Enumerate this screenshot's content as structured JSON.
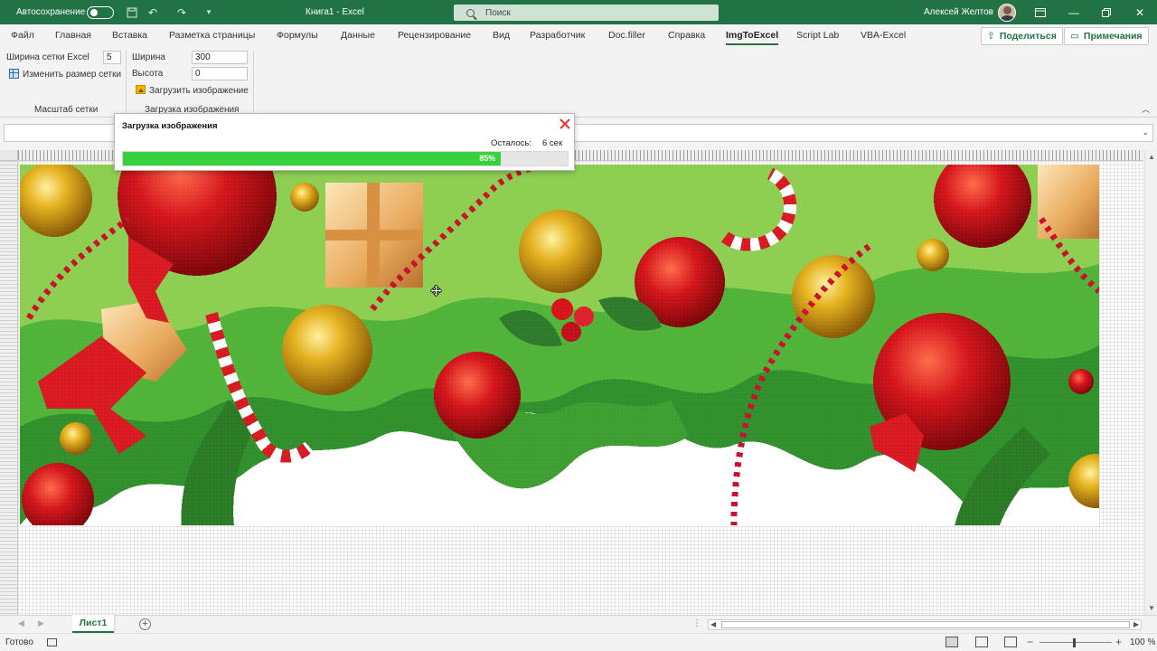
{
  "titlebar": {
    "autosave_label": "Автосохранение",
    "app_title": "Книга1  -  Excel",
    "search_placeholder": "Поиск",
    "user_name": "Алексей Желтов",
    "bg_color": "#217346"
  },
  "menu": {
    "tabs": [
      {
        "label": "Файл"
      },
      {
        "label": "Главная"
      },
      {
        "label": "Вставка"
      },
      {
        "label": "Разметка страницы"
      },
      {
        "label": "Формулы"
      },
      {
        "label": "Данные"
      },
      {
        "label": "Рецензирование"
      },
      {
        "label": "Вид"
      },
      {
        "label": "Разработчик"
      },
      {
        "label": "Doc.filler"
      },
      {
        "label": "Справка"
      },
      {
        "label": "ImgToExcel"
      },
      {
        "label": "Script Lab"
      },
      {
        "label": "VBA-Excel"
      }
    ],
    "active_tab": "ImgToExcel",
    "share_label": "Поделиться",
    "comments_label": "Примечания"
  },
  "ribbon": {
    "grid_size_label": "Ширина сетки Excel",
    "grid_size_value": "5",
    "resize_grid_label": "Изменить размер сетки",
    "group_scale_label": "Масштаб сетки",
    "width_label": "Ширина",
    "width_value": "300",
    "height_label": "Высота",
    "height_value": "0",
    "load_image_label": "Загрузить изображение",
    "group_load_label": "Загрузка изображения"
  },
  "dialog": {
    "title": "Загрузка изображения",
    "remaining_label": "Осталось:",
    "remaining_value": "6 сек",
    "progress_percent": 85,
    "progress_text": "85%",
    "progress_color": "#37d13d",
    "close_color": "#e23b2e"
  },
  "sheet_tabs": {
    "active": "Лист1"
  },
  "statusbar": {
    "ready": "Готово",
    "zoom": "100 %"
  }
}
